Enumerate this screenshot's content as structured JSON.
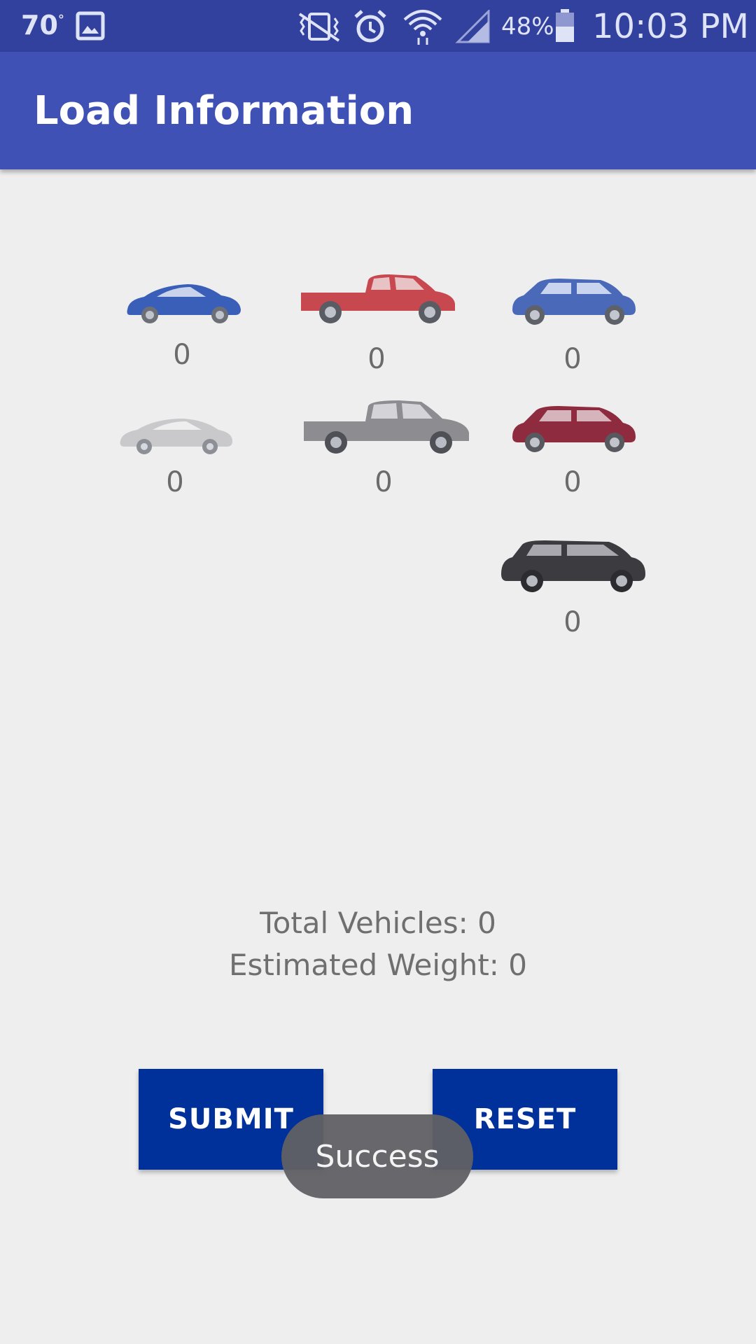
{
  "status_bar": {
    "temperature": "70",
    "degree_symbol": "°",
    "battery_percent": "48%",
    "time": "10:03 PM",
    "icons": [
      "image-icon",
      "vibrate-icon",
      "alarm-icon",
      "wifi-icon",
      "signal-icon",
      "battery-icon"
    ]
  },
  "app_bar": {
    "title": "Load Information"
  },
  "vehicles": [
    {
      "type": "compact-car",
      "color": "#3a5fb8",
      "count": "0"
    },
    {
      "type": "pickup-truck",
      "color": "#c8484f",
      "count": "0"
    },
    {
      "type": "compact-suv",
      "color": "#4a69b8",
      "count": "0"
    },
    {
      "type": "sedan",
      "color": "#c9c9cc",
      "count": "0"
    },
    {
      "type": "full-size-pickup",
      "color": "#8d8d91",
      "count": "0"
    },
    {
      "type": "crossover-suv",
      "color": "#8e2b3f",
      "count": "0"
    },
    {
      "type": "large-suv",
      "color": "#3c3c40",
      "count": "0"
    }
  ],
  "summary": {
    "total_vehicles": "Total Vehicles: 0",
    "estimated_weight": "Estimated Weight: 0"
  },
  "buttons": {
    "submit": "SUBMIT",
    "reset": "RESET"
  },
  "toast": {
    "message": "Success"
  },
  "colors": {
    "status_bar": "#32409e",
    "app_bar": "#3f51b5",
    "button": "#00319b",
    "background": "#eeeeef"
  }
}
